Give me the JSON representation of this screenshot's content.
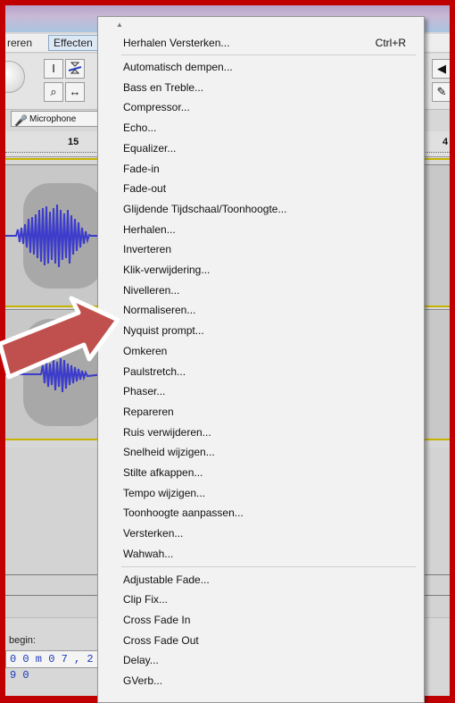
{
  "menubar": {
    "partial_label": "reren",
    "effects_label": "Effecten"
  },
  "toolbar": {
    "microphone_label": "Microphone"
  },
  "ruler": {
    "label_15": "15",
    "label_right": "4"
  },
  "selection": {
    "begin_label": "begin:",
    "time_value": "0 0 m 0 7 , 2 9 0"
  },
  "dropdown": {
    "repeat_item": {
      "label": "Herhalen Versterken...",
      "shortcut": "Ctrl+R"
    },
    "builtin_effects": [
      "Automatisch dempen...",
      "Bass en Treble...",
      "Compressor...",
      "Echo...",
      "Equalizer...",
      "Fade-in",
      "Fade-out",
      "Glijdende Tijdschaal/Toonhoogte...",
      "Herhalen...",
      "Inverteren",
      "Klik-verwijdering...",
      "Nivelleren...",
      "Normaliseren...",
      "Nyquist prompt...",
      "Omkeren",
      "Paulstretch...",
      "Phaser...",
      "Repareren",
      "Ruis verwijderen...",
      "Snelheid wijzigen...",
      "Stilte afkappen...",
      "Tempo wijzigen...",
      "Toonhoogte aanpassen...",
      "Versterken...",
      "Wahwah..."
    ],
    "plugin_effects": [
      "Adjustable Fade...",
      "Clip Fix...",
      "Cross Fade In",
      "Cross Fade Out",
      "Delay...",
      "GVerb..."
    ]
  },
  "colors": {
    "frame_border": "#c00000",
    "arrow": "#c0504d",
    "waveform": "#3b3bcc"
  }
}
